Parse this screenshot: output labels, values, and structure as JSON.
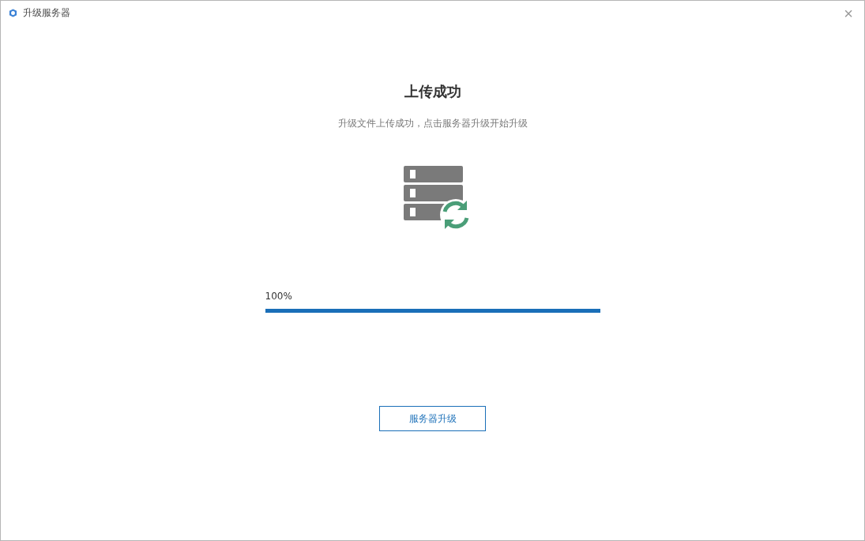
{
  "window": {
    "title": "升级服务器",
    "close": "×"
  },
  "heading": "上传成功",
  "message": "升级文件上传成功，点击服务器升级开始升级",
  "progress": {
    "reading": "100%",
    "level": 1
  },
  "buttons": [
    "服务器升级"
  ]
}
